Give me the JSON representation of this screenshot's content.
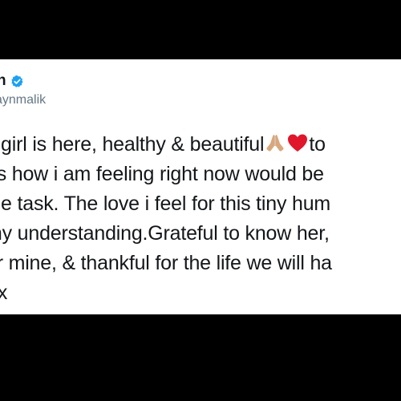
{
  "tweet": {
    "author": {
      "display_name": "n",
      "handle": "aynmalik",
      "verified_icon": "verified-badge-icon"
    },
    "lines": [
      {
        "before": "y girl is here, healthy & beautiful",
        "emoji_1": "folded-hands-icon",
        "emoji_2": "red-heart-icon",
        "after": "to"
      },
      {
        "text": "ds how i am feeling right now would be"
      },
      {
        "text": "ble task. The love i feel for this tiny hum"
      },
      {
        "text": "my understanding.Grateful to know her,"
      },
      {
        "text": "er mine, & thankful for the life we will ha"
      },
      {
        "text": "r x"
      }
    ]
  },
  "colors": {
    "background": "#000000",
    "card": "#ffffff",
    "text": "#14171a",
    "handle": "#657786",
    "verified": "#1da1f2",
    "heart": "#e0162b",
    "hands": "#d9a77c"
  }
}
